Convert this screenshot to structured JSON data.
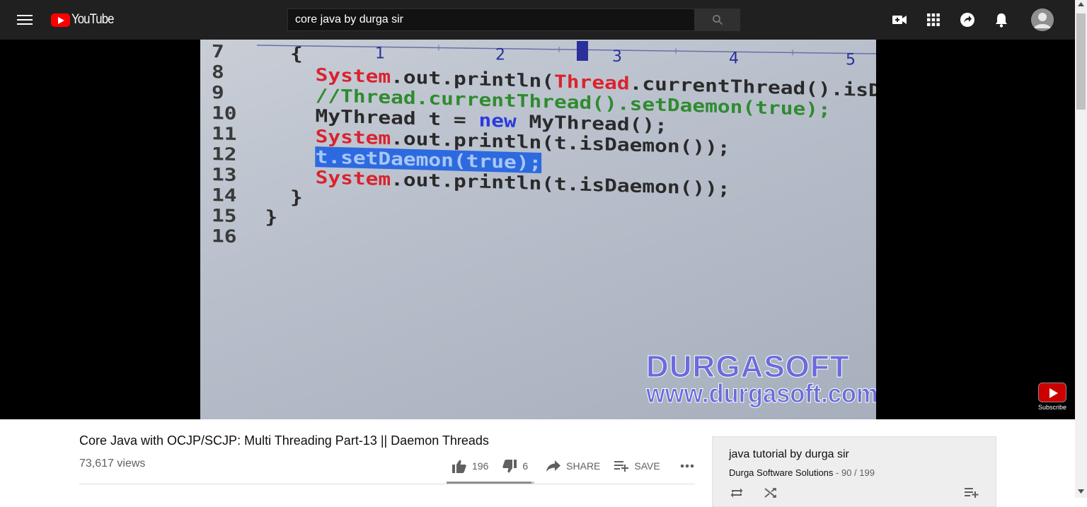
{
  "header": {
    "logo_text": "YouTube",
    "search_value": "core java by durga sir"
  },
  "video": {
    "code_lines": [
      {
        "num": "7",
        "parts": [
          {
            "t": "  {",
            "c": ""
          }
        ]
      },
      {
        "num": "8",
        "parts": [
          {
            "t": "    ",
            "c": ""
          },
          {
            "t": "System",
            "c": "red"
          },
          {
            "t": ".out.println(",
            "c": ""
          },
          {
            "t": "Thread",
            "c": "red"
          },
          {
            "t": ".currentThread().isD",
            "c": ""
          }
        ]
      },
      {
        "num": "9",
        "parts": [
          {
            "t": "    ",
            "c": ""
          },
          {
            "t": "//Thread.currentThread().setDaemon(true);",
            "c": "green"
          }
        ]
      },
      {
        "num": "10",
        "parts": [
          {
            "t": "    MyThread t = ",
            "c": ""
          },
          {
            "t": "new",
            "c": "blue"
          },
          {
            "t": " MyThread();",
            "c": ""
          }
        ]
      },
      {
        "num": "11",
        "parts": [
          {
            "t": "    ",
            "c": ""
          },
          {
            "t": "System",
            "c": "red"
          },
          {
            "t": ".out.println(t.isDaemon());",
            "c": ""
          }
        ]
      },
      {
        "num": "12",
        "parts": [
          {
            "t": "    ",
            "c": ""
          },
          {
            "t": "t.setDaemon(true);",
            "c": "hl"
          }
        ]
      },
      {
        "num": "13",
        "parts": [
          {
            "t": "    ",
            "c": ""
          },
          {
            "t": "System",
            "c": "red"
          },
          {
            "t": ".out.println(t.isDaemon());",
            "c": ""
          }
        ]
      },
      {
        "num": "14",
        "parts": [
          {
            "t": "  }",
            "c": ""
          }
        ]
      },
      {
        "num": "15",
        "parts": [
          {
            "t": "}",
            "c": ""
          }
        ]
      },
      {
        "num": "16",
        "parts": [
          {
            "t": "",
            "c": ""
          }
        ]
      }
    ],
    "ruler_marks": [
      "1",
      "2",
      "3",
      "4",
      "5"
    ],
    "watermark_line1": "DURGASOFT",
    "watermark_line2": "www.durgasoft.com",
    "subscribe_watermark": "Subscribe"
  },
  "info": {
    "title": "Core Java with OCJP/SCJP: Multi Threading Part-13 || Daemon Threads",
    "views": "73,617 views",
    "likes": "196",
    "dislikes": "6",
    "share_label": "SHARE",
    "save_label": "SAVE",
    "like_ratio": 0.97
  },
  "playlist": {
    "title": "java tutorial by durga sir",
    "channel": "Durga Software Solutions",
    "position": " - 90 / 199"
  },
  "colors": {
    "youtube_red": "#ff0000",
    "topbar": "#202020",
    "code_red": "#d9232e",
    "code_green": "#2f8b2f",
    "code_blue": "#2a39e0",
    "highlight": "#2d6ae0"
  }
}
